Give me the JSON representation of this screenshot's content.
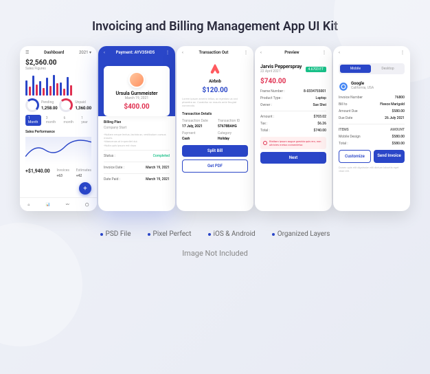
{
  "title": "Invoicing and Billing Management App UI Kit",
  "features": [
    "PSD File",
    "Pixel Perfect",
    "iOS & Android",
    "Organized Layers"
  ],
  "footer": "Image Not Included",
  "screen1": {
    "header": "Dashboard",
    "year": "2021",
    "amount": "$2,560.00",
    "amountLabel": "Sales Figures",
    "pending": {
      "label": "Pending",
      "val": "1,258.00"
    },
    "unpaid": {
      "label": "Unpaid",
      "val": "1,360.00"
    },
    "tabs": [
      "1 Month",
      "3 month",
      "6 month",
      "1 year"
    ],
    "perfLabel": "Sales Performance",
    "bottom": {
      "amt": "+$1,940.00",
      "inv": "Invoices",
      "invN": "+63",
      "est": "Estimates",
      "estN": "+42"
    }
  },
  "screen2": {
    "payment": "Payment: AYV35HD5",
    "name": "Ursula Gurnmeister",
    "date": "March 19, 2021",
    "amount": "$400.00",
    "planLabel": "Billing Plan",
    "planSub": "Company Start",
    "status": {
      "l": "Status :",
      "v": "Completed"
    },
    "invDate": {
      "l": "Invoice Date :",
      "v": "March 19, 2021"
    },
    "datePaid": {
      "l": "Date Paid :",
      "v": "March 19, 2021"
    }
  },
  "screen3": {
    "title": "Transaction Out",
    "brand": "Airbnb",
    "amount": "$120.00",
    "detailsLabel": "Transaction Details",
    "d1": {
      "l": "Transaction Date",
      "v": "17 July, 2021"
    },
    "d2": {
      "l": "Transaction ID",
      "v": "57678BAHG"
    },
    "pay": {
      "l": "Payment",
      "v": "Cash"
    },
    "cat": {
      "l": "Category",
      "v": "Holiday"
    },
    "btn1": "Split Bill",
    "btn2": "Get PDF"
  },
  "screen4": {
    "title": "Preview",
    "name": "Jarvis Pepperspray",
    "date": "22 April 2021",
    "badge": "4.6703 ET",
    "amount": "$740.00",
    "frame": {
      "l": "Frame Number :",
      "v": "8-0334755001"
    },
    "ptype": {
      "l": "Product Type :",
      "v": "Laptop"
    },
    "owner": {
      "l": "Owner :",
      "v": "Sue Shei"
    },
    "amt": {
      "l": "Amount :",
      "v": "$703.02"
    },
    "tax": {
      "l": "Tax :",
      "v": "$6.26"
    },
    "total": {
      "l": "Total :",
      "v": "$740.00"
    },
    "btn": "Next"
  },
  "screen5": {
    "tabs": [
      "Mobile",
      "Desktop"
    ],
    "brand": "Google",
    "loc": "California, USA",
    "invNum": {
      "l": "Invoice Number",
      "v": "76800"
    },
    "billTo": {
      "l": "Bill to",
      "v": "Fleece Marigold"
    },
    "amtDue": {
      "l": "Amount Due",
      "v": "$580.00"
    },
    "dueDate": {
      "l": "Due Date",
      "v": "26 July 2021"
    },
    "itemsH": {
      "l": "ITEMS",
      "v": "AMOUNT"
    },
    "item1": {
      "l": "Mobile Design",
      "v": "$580.00"
    },
    "total": {
      "l": "Total :",
      "v": "$580.00"
    },
    "btn1": "Customize",
    "btn2": "Send Invoice"
  }
}
